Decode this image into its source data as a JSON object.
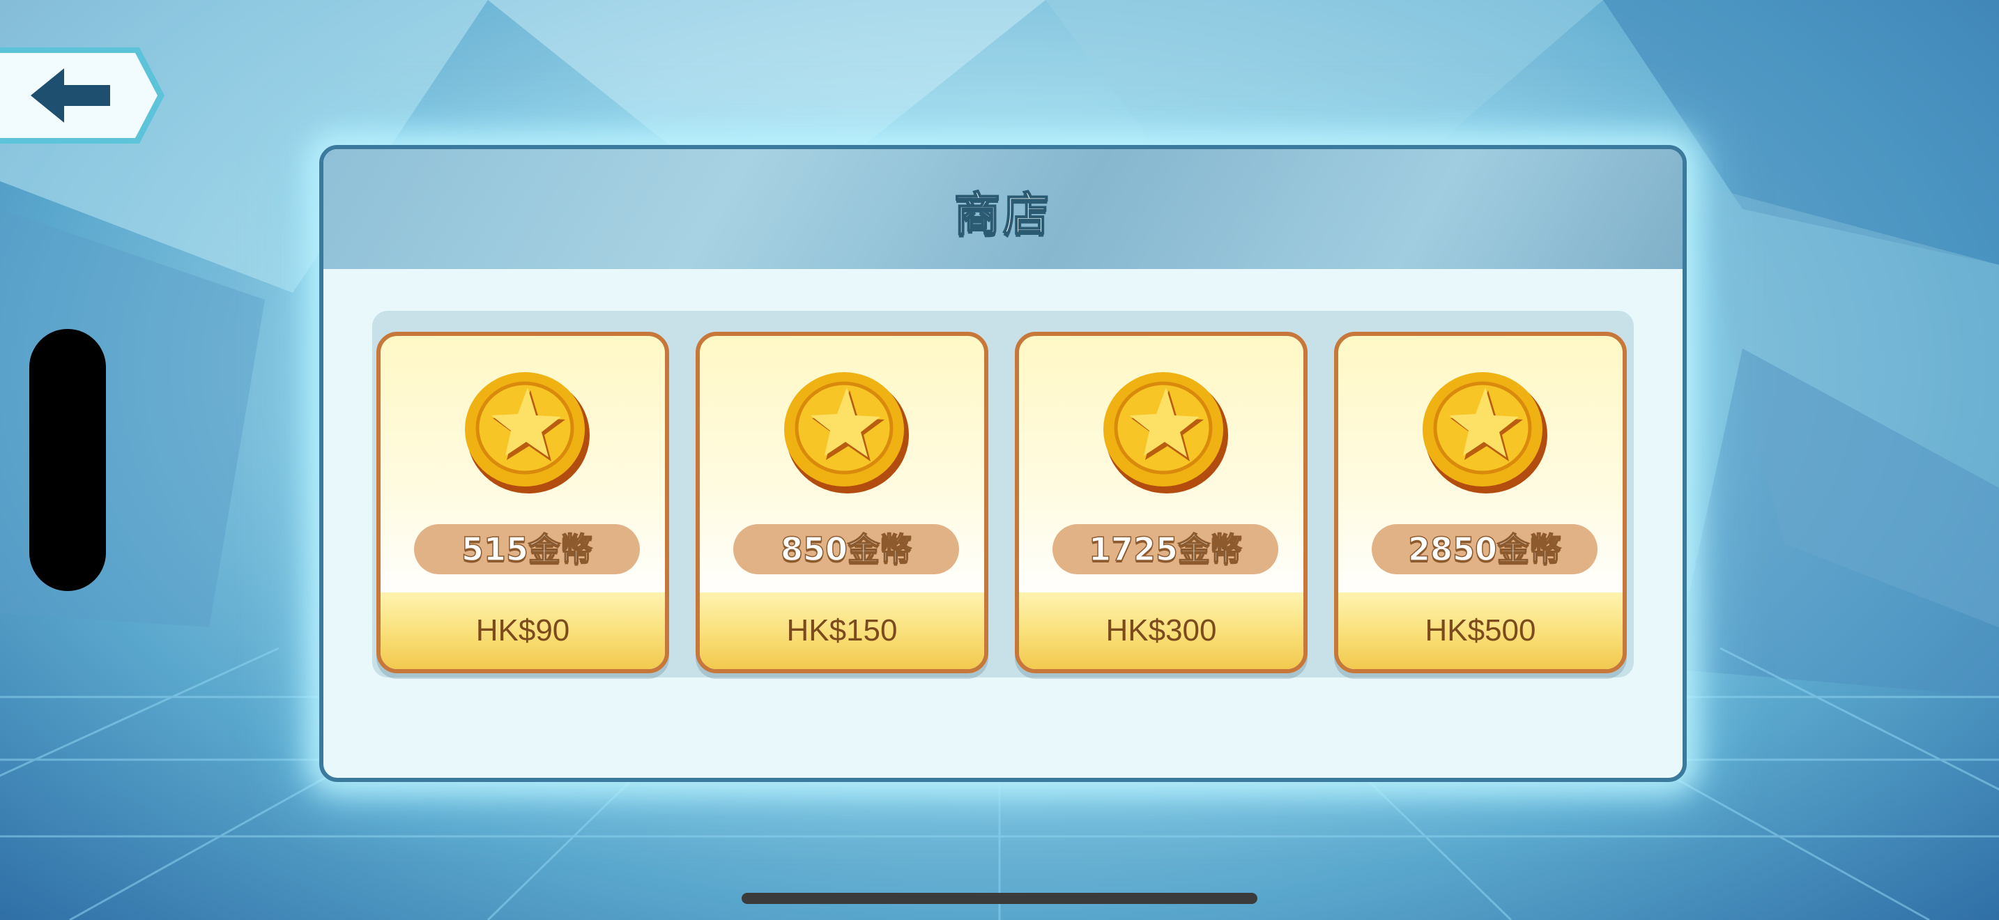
{
  "title": "商店",
  "products": [
    {
      "amount": "515金幣",
      "price": "HK$90"
    },
    {
      "amount": "850金幣",
      "price": "HK$150"
    },
    {
      "amount": "1725金幣",
      "price": "HK$300"
    },
    {
      "amount": "2850金幣",
      "price": "HK$500"
    }
  ],
  "icons": {
    "back": "back-arrow-icon",
    "coin": "gold-star-coin-icon"
  },
  "colors": {
    "card_border": "#c7773a",
    "amount_pill": "#e2b287",
    "price_bar": "#f9df78",
    "panel_border": "#3c7a9d"
  }
}
